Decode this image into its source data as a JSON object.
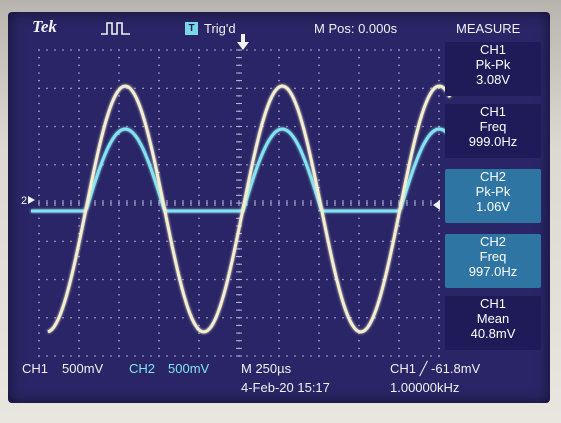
{
  "header": {
    "brand": "Tek",
    "acquire_icon": "pulse-icon",
    "trigger_badge": "T",
    "trigger_status": "Trig'd",
    "position": "M Pos: 0.000s",
    "menu_title": "MEASURE"
  },
  "measurements": [
    {
      "source": "CH1",
      "type": "Pk-Pk",
      "value": "3.08V"
    },
    {
      "source": "CH1",
      "type": "Freq",
      "value": "999.0Hz"
    },
    {
      "source": "CH2",
      "type": "Pk-Pk",
      "value": "1.06V"
    },
    {
      "source": "CH2",
      "type": "Freq",
      "value": "997.0Hz"
    },
    {
      "source": "CH1",
      "type": "Mean",
      "value": "40.8mV"
    }
  ],
  "footer": {
    "ch1_label": "CH1",
    "ch1_scale": "500mV",
    "ch2_label": "CH2",
    "ch2_scale": "500mV",
    "timebase": "M 250µs",
    "trigger_setting": "CH1 ╱ -61.8mV",
    "date": "4-Feb-20 15:17",
    "trigger_freq": "1.00000kHz"
  },
  "markers": {
    "ground": "2"
  },
  "colors": {
    "ch1": "#f3eecf",
    "ch2": "#83e3f0",
    "screen": "#2a2566"
  }
}
